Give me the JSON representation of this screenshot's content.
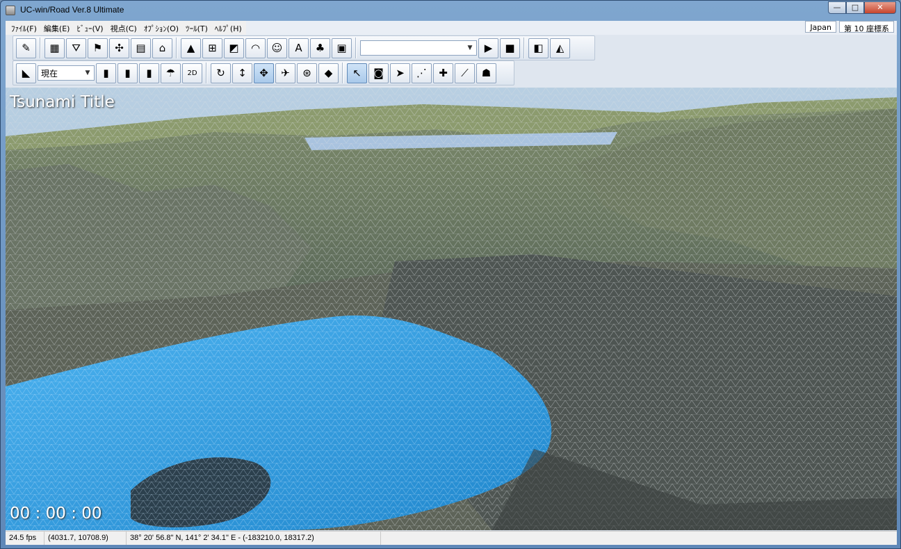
{
  "window": {
    "title": "UC-win/Road Ver.8 Ultimate",
    "minimize": "—",
    "maximize": "□",
    "close": "✕"
  },
  "menu": [
    "ﾌｧｲﾙ(F)",
    "編集(E)",
    "ﾋﾞｭｰ(V)",
    "視点(C)",
    "ｵﾌﾟｼｮﾝ(O)",
    "ﾂｰﾙ(T)",
    "ﾍﾙﾌﾟ(H)"
  ],
  "badges": {
    "region": "Japan",
    "coord_system": "第 10 座標系"
  },
  "toolbar2": {
    "time_combo": "現在"
  },
  "viewport": {
    "title": "Tsunami Title",
    "timer": "00 : 00 : 00"
  },
  "status": {
    "fps": "24.5 fps",
    "xy": "(4031.7, 10708.9)",
    "latlon": "38° 20' 56.8\" N, 141° 2' 34.1\" E  -  (-183210.0, 18317.2)"
  },
  "colors": {
    "sea": "#2f9be0",
    "terrain": "#6b7a5e",
    "sky": "#a8c4db",
    "accent": "#3c6fa8"
  }
}
